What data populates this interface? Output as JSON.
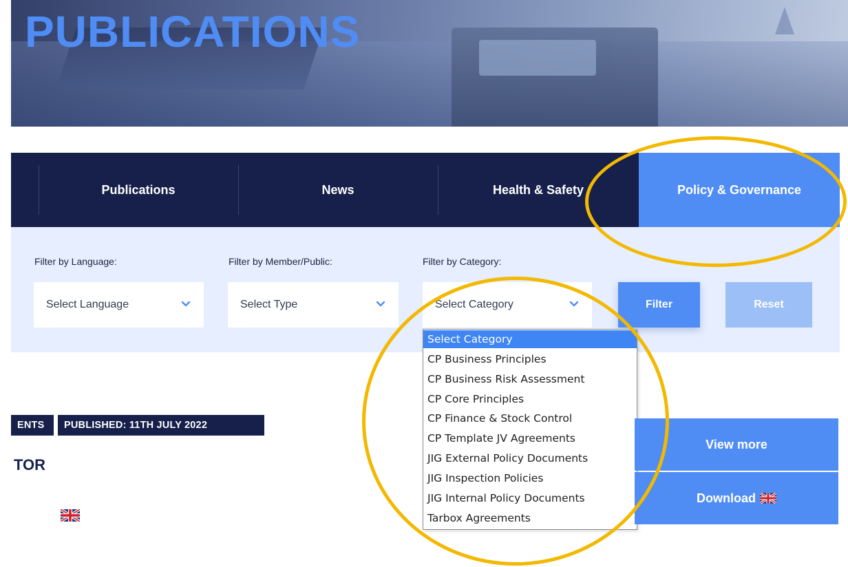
{
  "hero": {
    "title": "PUBLICATIONS"
  },
  "nav": {
    "items": [
      {
        "label": "Publications"
      },
      {
        "label": "News"
      },
      {
        "label": "Health & Safety"
      },
      {
        "label": "Policy & Governance",
        "active": true
      }
    ]
  },
  "filters": {
    "language": {
      "label": "Filter by Language:",
      "value": "Select Language"
    },
    "member": {
      "label": "Filter by Member/Public:",
      "value": "Select Type"
    },
    "category": {
      "label": "Filter by Category:",
      "value": "Select Category"
    },
    "filter_button": "Filter",
    "reset_button": "Reset"
  },
  "dropdown": {
    "options": [
      "Select Category",
      "CP Business Principles",
      "CP Business Risk Assessment",
      "CP Core Principles",
      "CP Finance & Stock Control",
      "CP Template JV Agreements",
      "JIG External Policy Documents",
      "JIG Inspection Policies",
      "JIG Internal Policy Documents",
      "Tarbox Agreements"
    ],
    "selected_index": 0
  },
  "article": {
    "tag_partial": "ENTS",
    "published": "PUBLISHED: 11TH JULY 2022",
    "title_partial": "TOR",
    "view_more": "View more",
    "download": "Download"
  },
  "colors": {
    "navy": "#16204a",
    "accent_blue": "#4f8df5",
    "highlight": "#f3b800",
    "panel": "#e6eeff"
  },
  "icons": [
    "chevron-down-icon",
    "uk-flag-icon"
  ]
}
